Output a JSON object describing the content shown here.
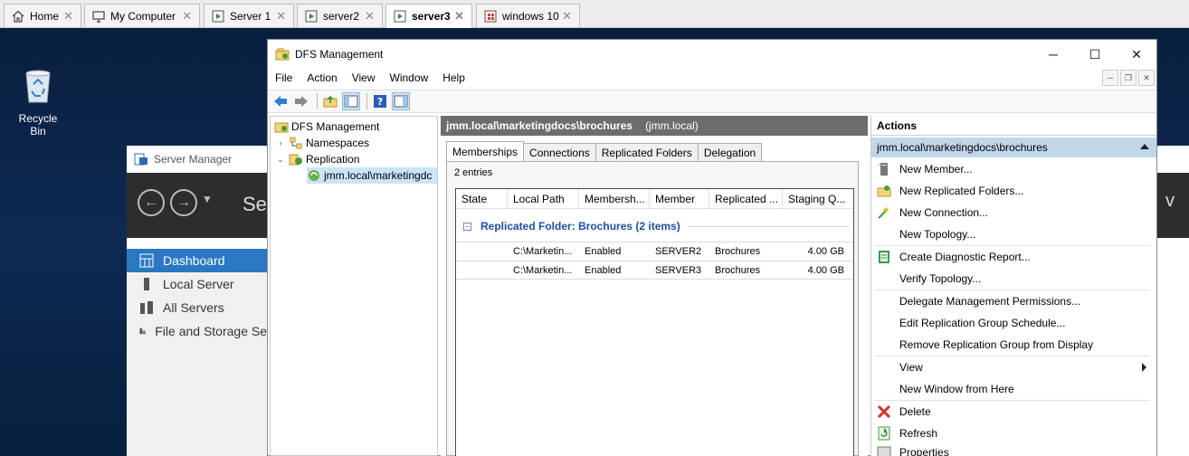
{
  "vm_tabs": [
    {
      "label": "Home",
      "icon": "home-icon"
    },
    {
      "label": "My Computer",
      "icon": "monitor-icon"
    },
    {
      "label": "Server 1",
      "icon": "vm-icon"
    },
    {
      "label": "server2",
      "icon": "vm-icon"
    },
    {
      "label": "server3",
      "icon": "vm-icon",
      "active": true
    },
    {
      "label": "windows 10",
      "icon": "vm-windows-icon"
    }
  ],
  "desktop": {
    "recycle_bin_label": "Recycle Bin"
  },
  "server_manager": {
    "title": "Server Manager",
    "header_title": "Se",
    "header_right": "v",
    "sidebar": [
      {
        "label": "Dashboard",
        "selected": true
      },
      {
        "label": "Local Server"
      },
      {
        "label": "All Servers"
      },
      {
        "label": "File and Storage Se"
      }
    ]
  },
  "dfs": {
    "title": "DFS Management",
    "menu": [
      "File",
      "Action",
      "View",
      "Window",
      "Help"
    ],
    "tree": {
      "root": "DFS Management",
      "namespaces": "Namespaces",
      "replication": "Replication",
      "selected_group": "jmm.local\\marketingdc"
    },
    "middle": {
      "header": "jmm.local\\marketingdocs\\brochures",
      "header_scope": "(jmm.local)",
      "tabs": [
        "Memberships",
        "Connections",
        "Replicated Folders",
        "Delegation"
      ],
      "active_tab": "Memberships",
      "entries": "2 entries",
      "columns": [
        "State",
        "Local Path",
        "Membersh...",
        "Member",
        "Replicated ...",
        "Staging Q..."
      ],
      "group_label": "Replicated Folder: Brochures (2 items)",
      "rows": [
        {
          "state": "",
          "local_path": "C:\\Marketin...",
          "membership": "Enabled",
          "member": "SERVER2",
          "replicated": "Brochures",
          "staging": "4.00 GB"
        },
        {
          "state": "",
          "local_path": "C:\\Marketin...",
          "membership": "Enabled",
          "member": "SERVER3",
          "replicated": "Brochures",
          "staging": "4.00 GB"
        }
      ]
    },
    "actions": {
      "title": "Actions",
      "section": "jmm.local\\marketingdocs\\brochures",
      "items": [
        {
          "label": "New Member...",
          "icon": "new-member-icon"
        },
        {
          "label": "New Replicated Folders...",
          "icon": "new-replicated-folders-icon"
        },
        {
          "label": "New Connection...",
          "icon": "new-connection-icon"
        },
        {
          "label": "New Topology...",
          "icon": ""
        },
        {
          "label": "Create Diagnostic Report...",
          "icon": "diagnostic-report-icon"
        },
        {
          "label": "Verify Topology...",
          "icon": ""
        },
        {
          "label": "Delegate Management Permissions...",
          "icon": ""
        },
        {
          "label": "Edit Replication Group Schedule...",
          "icon": ""
        },
        {
          "label": "Remove Replication Group from Display",
          "icon": ""
        },
        {
          "label": "View",
          "icon": "",
          "submenu": true
        },
        {
          "label": "New Window from Here",
          "icon": ""
        },
        {
          "label": "Delete",
          "icon": "delete-icon"
        },
        {
          "label": "Refresh",
          "icon": "refresh-icon"
        },
        {
          "label": "Properties",
          "icon": "properties-icon"
        }
      ]
    }
  }
}
